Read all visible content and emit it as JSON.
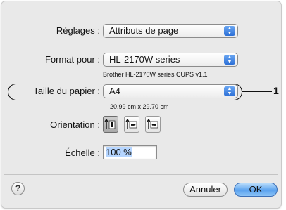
{
  "settings": {
    "label": "Réglages :",
    "value": "Attributs de page"
  },
  "format_for": {
    "label": "Format pour :",
    "value": "HL-2170W series",
    "detail": "Brother HL-2170W series CUPS v1.1"
  },
  "paper_size": {
    "label": "Taille du papier :",
    "value": "A4",
    "dimensions": "20.99 cm x 29.70 cm"
  },
  "callout": {
    "number": "1"
  },
  "orientation": {
    "label": "Orientation :",
    "options": [
      "portrait",
      "landscape",
      "reverse-landscape"
    ],
    "selected": "portrait"
  },
  "scale": {
    "label": "Échelle :",
    "value": "100 %"
  },
  "buttons": {
    "help": "?",
    "cancel": "Annuler",
    "ok": "OK"
  },
  "colors": {
    "accent_blue": "#2c6fd6",
    "ok_button": "#5aa2ee",
    "dialog_bg": "#e9e9e9"
  },
  "icons": {
    "popup_arrows": "updown-arrows-icon",
    "help": "question-icon"
  }
}
